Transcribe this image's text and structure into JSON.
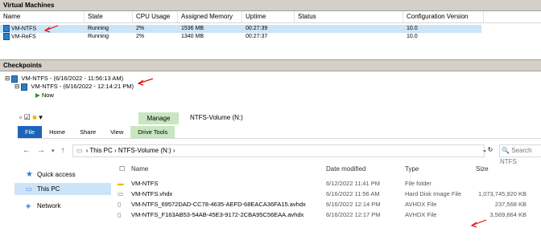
{
  "vm_panel": {
    "title": "Virtual Machines",
    "columns": [
      "Name",
      "State",
      "CPU Usage",
      "Assigned Memory",
      "Uptime",
      "Status",
      "Configuration Version"
    ],
    "rows": [
      {
        "name": "VM-NTFS",
        "state": "Running",
        "cpu": "2%",
        "memory": "1536 MB",
        "uptime": "00:27:39",
        "status": "",
        "version": "10.0"
      },
      {
        "name": "VM-ReFS",
        "state": "Running",
        "cpu": "2%",
        "memory": "1340 MB",
        "uptime": "00:27:37",
        "status": "",
        "version": "10.0"
      }
    ]
  },
  "checkpoints": {
    "title": "Checkpoints",
    "items": [
      "VM-NTFS - (6/16/2022 - 11:56:13 AM)",
      "VM-NTFS - (6/16/2022 - 12:14:21 PM)",
      "Now"
    ]
  },
  "explorer": {
    "window_title": "NTFS-Volume (N:)",
    "manage_label": "Manage",
    "tabs": [
      "File",
      "Home",
      "Share",
      "View",
      "Drive Tools"
    ],
    "breadcrumb": [
      "This PC",
      "NTFS-Volume (N:)"
    ],
    "search_placeholder": "Search NTFS",
    "nav": [
      "Quick access",
      "This PC",
      "Network"
    ],
    "columns": [
      "Name",
      "Date modified",
      "Type",
      "Size"
    ],
    "files": [
      {
        "name": "VM-NTFS",
        "date": "6/12/2022 11:41 PM",
        "type": "File folder",
        "size": ""
      },
      {
        "name": "VM-NTFS.vhdx",
        "date": "6/16/2022 11:56 AM",
        "type": "Hard Disk Image File",
        "size": "1,073,745,920 KB"
      },
      {
        "name": "VM-NTFS_69572DAD-CC78-4635-AEFD-68EACA36FA15.avhdx",
        "date": "6/16/2022 12:14 PM",
        "type": "AVHDX File",
        "size": "237,568 KB"
      },
      {
        "name": "VM-NTFS_F163AB53-54AB-45E3-9172-2CBA95C56EAA.avhdx",
        "date": "6/16/2022 12:17 PM",
        "type": "AVHDX File",
        "size": "3,569,664 KB"
      }
    ]
  },
  "colors": {
    "accent": "#1a65b9",
    "selection": "#cce4f7",
    "manage": "#c8e6c0",
    "annotation": "#dd1111"
  }
}
